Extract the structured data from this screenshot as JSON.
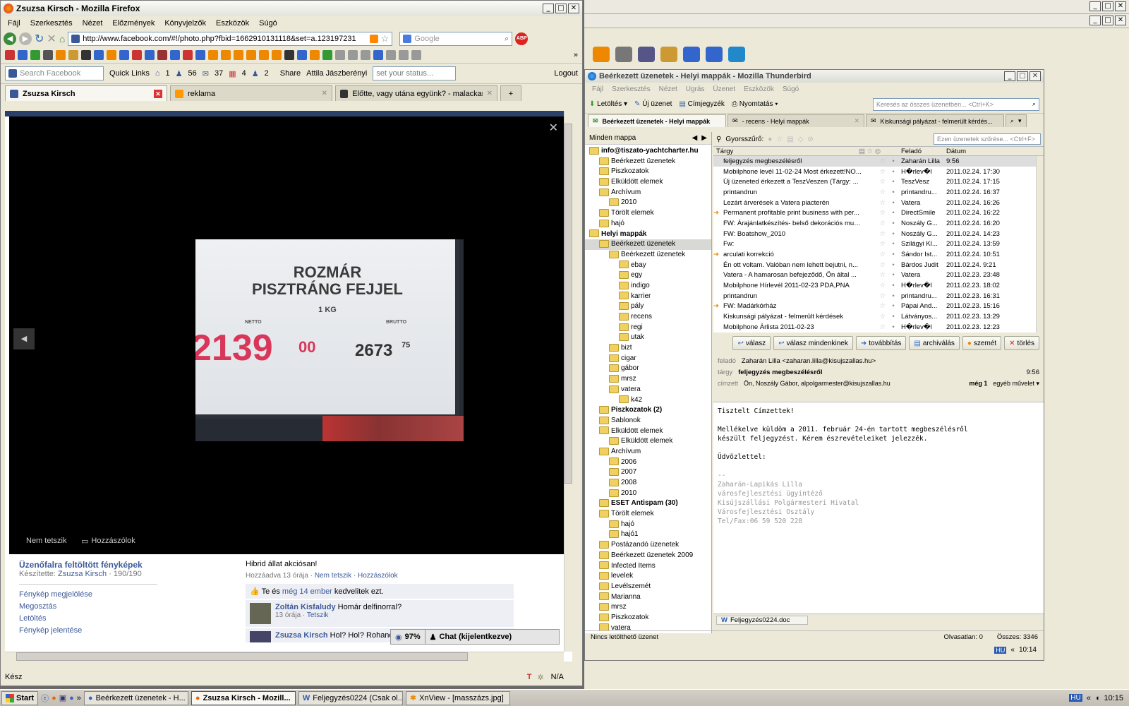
{
  "firefox": {
    "title": "Zsuzsa Kirsch - Mozilla Firefox",
    "menu": [
      "Fájl",
      "Szerkesztés",
      "Nézet",
      "Előzmények",
      "Könyvjelzők",
      "Eszközök",
      "Súgó"
    ],
    "url": "http://www.facebook.com/#!/photo.php?fbid=1662910131118&set=a.123197231",
    "search_placeholder": "Google",
    "fb_search_placeholder": "Search Facebook",
    "quick_links": "Quick Links",
    "counts": [
      "1",
      "56",
      "37",
      "4",
      "2"
    ],
    "share": "Share",
    "user": "Attila Jászberényi",
    "status_placeholder": "set your status...",
    "logout": "Logout",
    "tabs": [
      "Zsuzsa Kirsch",
      "reklama",
      "Előtte, vagy utána együnk? - malackaraj"
    ],
    "photo": {
      "line1": "ROZMÁR",
      "line2": "PISZTRÁNG FEJJEL",
      "weight": "1 KG",
      "netto_label": "NETTO",
      "brutto_label": "BRUTTO",
      "net_price": "2139",
      "net_cents": "00",
      "gross_price": "2673",
      "gross_cents": "75"
    },
    "photo_actions": [
      "Nem tetszik",
      "Hozzászólok"
    ],
    "album_title": "Üzenőfalra feltöltött fényképek",
    "made_by_label": "Készítette:",
    "made_by": "Zsuzsa Kirsch",
    "album_count": "190/190",
    "left_links": [
      "Fénykép megjelölése",
      "Megosztás",
      "Letöltés",
      "Fénykép jelentése"
    ],
    "caption": "Hibrid állat akciósan!",
    "caption_meta": [
      "Hozzáadva 13 órája",
      "Nem tetszik",
      "Hozzászólok"
    ],
    "likes_pre": "Te és",
    "likes_link": "még 14 ember",
    "likes_post": "kedvelitek ezt.",
    "comments": [
      {
        "author": "Zoltán Kisfaludy",
        "text": "Homár delfinorral?",
        "time": "13 órája",
        "like": "Tetszik"
      },
      {
        "author": "Zsuzsa Kirsch",
        "text": "Hol? Hol? Rohanok!"
      }
    ],
    "chat_percent": "97%",
    "chat_label": "Chat (kijelentkezve)",
    "status": "Kész",
    "status_right": "N/A"
  },
  "thunderbird": {
    "title": "Beérkezett üzenetek - Helyi mappák - Mozilla Thunderbird",
    "menu": [
      "Fájl",
      "Szerkesztés",
      "Nézet",
      "Ugrás",
      "Üzenet",
      "Eszközök",
      "Súgó"
    ],
    "toolbar": [
      "Letöltés",
      "Új üzenet",
      "Címjegyzék",
      "Nyomtatás"
    ],
    "search_placeholder": "Keresés az összes üzenetben... <Ctrl+K>",
    "tabs": [
      "Beérkezett üzenetek - Helyi mappák",
      "- recens - Helyi mappák",
      "Kiskunsági pályázat - felmerült kérdés..."
    ],
    "folder_header": "Minden mappa",
    "quick_filter": "Gyorsszűrő:",
    "filter_placeholder": "Ezen üzenetek szűrése... <Ctrl+F>",
    "folders": [
      {
        "d": 0,
        "t": "info@tiszato-yachtcharter.hu",
        "b": true
      },
      {
        "d": 1,
        "t": "Beérkezett üzenetek"
      },
      {
        "d": 1,
        "t": "Piszkozatok"
      },
      {
        "d": 1,
        "t": "Elküldött elemek"
      },
      {
        "d": 1,
        "t": "Archívum"
      },
      {
        "d": 2,
        "t": "2010"
      },
      {
        "d": 1,
        "t": "Törölt elemek"
      },
      {
        "d": 1,
        "t": "hajó"
      },
      {
        "d": 0,
        "t": "Helyi mappák",
        "b": true
      },
      {
        "d": 1,
        "t": "Beérkezett üzenetek",
        "sel": true
      },
      {
        "d": 2,
        "t": "Beérkezett üzenetek"
      },
      {
        "d": 3,
        "t": "ebay"
      },
      {
        "d": 3,
        "t": "egy"
      },
      {
        "d": 3,
        "t": "indigo"
      },
      {
        "d": 3,
        "t": "karrier"
      },
      {
        "d": 3,
        "t": "pály"
      },
      {
        "d": 3,
        "t": "recens"
      },
      {
        "d": 3,
        "t": "regi"
      },
      {
        "d": 3,
        "t": "utak"
      },
      {
        "d": 2,
        "t": "bizt"
      },
      {
        "d": 2,
        "t": "cigar"
      },
      {
        "d": 2,
        "t": "gábor"
      },
      {
        "d": 2,
        "t": "mrsz"
      },
      {
        "d": 2,
        "t": "vatera"
      },
      {
        "d": 3,
        "t": "k42"
      },
      {
        "d": 1,
        "t": "Piszkozatok (2)",
        "b": true
      },
      {
        "d": 1,
        "t": "Sablonok"
      },
      {
        "d": 1,
        "t": "Elküldött elemek"
      },
      {
        "d": 2,
        "t": "Elküldött elemek"
      },
      {
        "d": 1,
        "t": "Archívum"
      },
      {
        "d": 2,
        "t": "2006"
      },
      {
        "d": 2,
        "t": "2007"
      },
      {
        "d": 2,
        "t": "2008"
      },
      {
        "d": 2,
        "t": "2010"
      },
      {
        "d": 1,
        "t": "ESET Antispam (30)",
        "b": true
      },
      {
        "d": 1,
        "t": "Törölt elemek"
      },
      {
        "d": 2,
        "t": "hajó"
      },
      {
        "d": 2,
        "t": "hajó1"
      },
      {
        "d": 1,
        "t": "Postázandó üzenetek"
      },
      {
        "d": 1,
        "t": "Beérkezett üzenetek 2009"
      },
      {
        "d": 1,
        "t": "Infected Items"
      },
      {
        "d": 1,
        "t": "levelek"
      },
      {
        "d": 1,
        "t": "Levélszemét"
      },
      {
        "d": 1,
        "t": "Marianna"
      },
      {
        "d": 1,
        "t": "mrsz"
      },
      {
        "d": 1,
        "t": "Piszkozatok"
      },
      {
        "d": 1,
        "t": "vatera"
      }
    ],
    "columns": [
      "Tárgy",
      "Feladó",
      "Dátum"
    ],
    "messages": [
      {
        "s": "feljegyzés megbeszélésről",
        "f": "Zaharán Lilla",
        "d": "9:56",
        "sel": true
      },
      {
        "s": "Mobilphone levél 11-02-24 Most érkezett!NO...",
        "f": "H�rlev�l",
        "d": "2011.02.24. 17:30"
      },
      {
        "s": "Új üzeneted érkezett a TeszVeszen (Tárgy: ...",
        "f": "TeszVesz",
        "d": "2011.02.24. 17:15"
      },
      {
        "s": "printandrun",
        "f": "printandru...",
        "d": "2011.02.24. 16:37"
      },
      {
        "s": "Lezárt árverések a Vatera piacterén",
        "f": "Vatera",
        "d": "2011.02.24. 16:26"
      },
      {
        "s": "Permanent profitable print business with per...",
        "f": "DirectSmile",
        "d": "2011.02.24. 16:22",
        "r": true
      },
      {
        "s": "FW: Árajánlatkészítés- belső dekorációs mun...",
        "f": "Noszály G...",
        "d": "2011.02.24. 16:20"
      },
      {
        "s": "FW: Boatshow_2010",
        "f": "Noszály G...",
        "d": "2011.02.24. 14:23"
      },
      {
        "s": "Fw:",
        "f": "Szilágyi Kl...",
        "d": "2011.02.24. 13:59"
      },
      {
        "s": "arculati korrekció",
        "f": "Sándor Ist...",
        "d": "2011.02.24. 10:51",
        "r": true
      },
      {
        "s": "Én ott voltam. Valóban nem lehett bejutni, n...",
        "f": "Bárdos Judit",
        "d": "2011.02.24. 9:21"
      },
      {
        "s": "Vatera - A hamarosan befejeződő, Ön által ...",
        "f": "Vatera",
        "d": "2011.02.23. 23:48"
      },
      {
        "s": "Mobilphone Hírlevél 2011-02-23  PDA,PNA",
        "f": "H�rlev�l",
        "d": "2011.02.23. 18:02"
      },
      {
        "s": "printandrun",
        "f": "printandru...",
        "d": "2011.02.23. 16:31"
      },
      {
        "s": "FW: Madárkórház",
        "f": "Pápai And...",
        "d": "2011.02.23. 15:16",
        "r": true
      },
      {
        "s": "Kiskunsági pályázat - felmerült kérdések",
        "f": "Látványos...",
        "d": "2011.02.23. 13:29"
      },
      {
        "s": "Mobilphone Árlista 2011-02-23",
        "f": "H�rlev�l",
        "d": "2011.02.23. 12:23"
      }
    ],
    "actions": [
      "válasz",
      "válasz mindenkinek",
      "továbbítás",
      "archiválás",
      "szemét",
      "törlés"
    ],
    "header": {
      "from_label": "feladó",
      "from": "Zaharán Lilla <zaharan.lilla@kisujszallas.hu>",
      "subject_label": "tárgy",
      "subject": "feljegyzés megbeszélésről",
      "time": "9:56",
      "to_label": "címzett",
      "to": "Ön, Noszály Gábor, alpolgarmester@kisujszallas.hu",
      "more": "még 1",
      "other": "egyéb művelet"
    },
    "body": [
      "Tisztelt Címzettek!",
      "",
      "Mellékelve küldöm a 2011. február 24-én tartott megbeszélésről",
      "készült feljegyzést. Kérem észrevételeiket jelezzék.",
      "",
      "Üdvözlettel:",
      "",
      "--",
      "Zaharán-Lapikás Lilla",
      "városfejlesztési ügyintéző",
      "Kisújszállási Polgármesteri Hivatal",
      "Városfejlesztési Osztály",
      "Tel/Fax:06 59 520 228"
    ],
    "attachment": "Feljegyzés0224.doc",
    "status_left": "Nincs letölthető üzenet",
    "unread": "Olvasatlan: 0",
    "total": "Összes: 3346"
  },
  "right_tray": {
    "lang": "HU",
    "time": "10:14"
  },
  "taskbar": {
    "start": "Start",
    "tasks": [
      "Beérkezett üzenetek - H...",
      "Zsuzsa Kirsch - Mozill...",
      "Feljegyzés0224 (Csak ol...",
      "XnView - [masszázs.jpg]"
    ],
    "lang": "HU",
    "time": "10:15"
  }
}
